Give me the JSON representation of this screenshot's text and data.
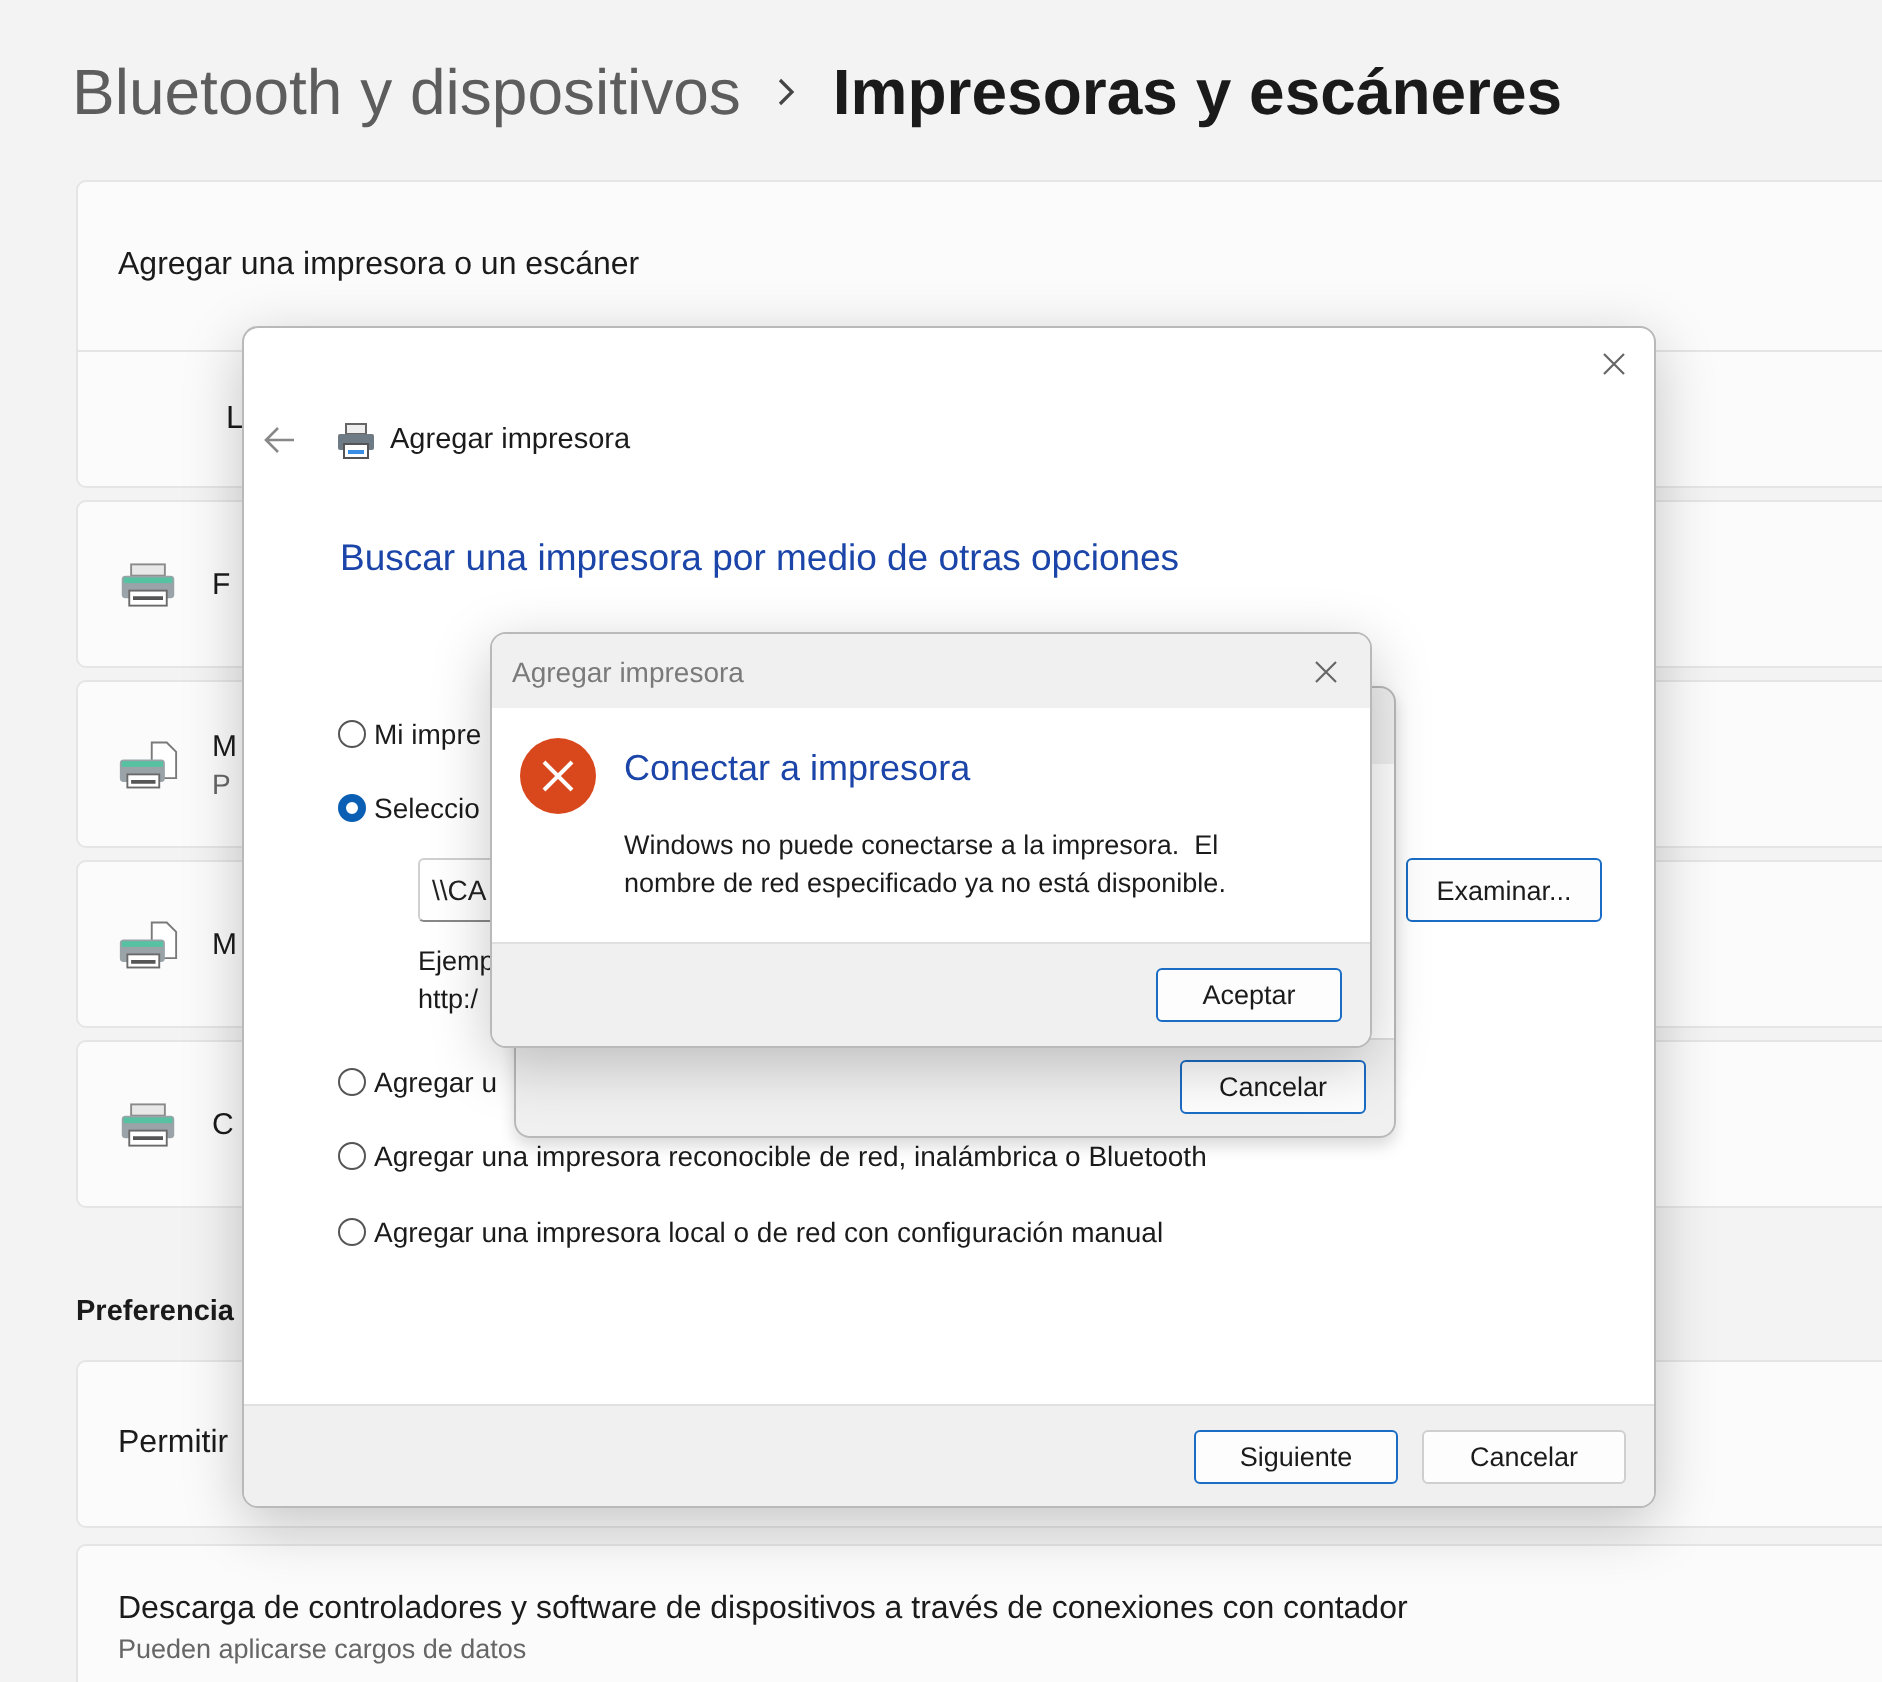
{
  "breadcrumb": {
    "parent": "Bluetooth y dispositivos",
    "current": "Impresoras y escáneres"
  },
  "settings": {
    "add_card": {
      "title": "Agregar una impresora o un escáner",
      "row_text": "L"
    },
    "printers": [
      {
        "kind": "printer",
        "name": "F"
      },
      {
        "kind": "mfp",
        "name": "M",
        "status": "P"
      },
      {
        "kind": "mfp",
        "name": "M"
      },
      {
        "kind": "printer",
        "name": "C"
      }
    ],
    "preferences_heading": "Preferencia",
    "preferences": [
      {
        "title": "Permitir"
      },
      {
        "title": "Descarga de controladores y software de dispositivos a través de conexiones con contador",
        "subtitle": "Pueden aplicarse cargos de datos"
      }
    ]
  },
  "add_printer_wizard": {
    "title": "Agregar impresora",
    "heading": "Buscar una impresora por medio de otras opciones",
    "options": [
      {
        "label": "Mi impre",
        "selected": false
      },
      {
        "label": "Seleccio",
        "selected": true,
        "field_value": "\\\\CA",
        "example_lines": [
          "Ejemp",
          "http:/"
        ]
      },
      {
        "label": "Agregar u",
        "selected": false
      },
      {
        "label": "Agregar una impresora reconocible de red, inalámbrica o Bluetooth",
        "selected": false
      },
      {
        "label": "Agregar una impresora local o de red con configuración manual",
        "selected": false
      }
    ],
    "browse_button": "Examinar...",
    "buttons": [
      {
        "label": "Siguiente",
        "default": true
      },
      {
        "label": "Cancelar",
        "default": false
      }
    ]
  },
  "background_dialog": {
    "buttons": [
      {
        "label": "Cancelar",
        "default": true
      }
    ]
  },
  "error_dialog": {
    "title": "Agregar impresora",
    "heading": "Conectar a impresora",
    "message": "Windows no puede conectarse a la impresora.  El nombre de red especificado ya no está disponible.",
    "buttons": [
      {
        "label": "Aceptar",
        "default": true
      }
    ]
  }
}
